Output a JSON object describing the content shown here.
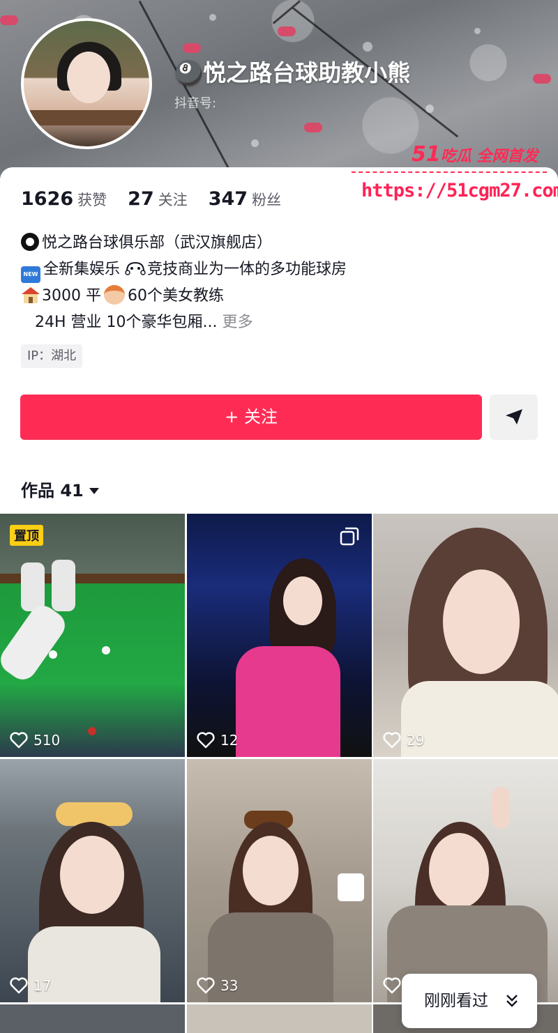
{
  "profile": {
    "name": "🎱悦之路台球助教小熊",
    "douyin_id_label": "抖音号:"
  },
  "stats": {
    "likes_value": "1626",
    "likes_label": "获赞",
    "following_value": "27",
    "following_label": "关注",
    "followers_value": "347",
    "followers_label": "粉丝"
  },
  "bio": {
    "line1": "悦之路台球俱乐部（武汉旗舰店）",
    "line2_a": "全新集娱乐",
    "line2_b": "竞技商业为一体的多功能球房",
    "line3_a": "3000 平",
    "line3_b": "60个美女教练",
    "line4": "24H 营业 10个豪华包厢...",
    "more": "更多",
    "new_badge": "NEW"
  },
  "ip_label": "IP：湖北",
  "watermark": {
    "brand_num": "51",
    "brand_text": "吃瓜 全网首发",
    "url": "https://51cgm27.com"
  },
  "actions": {
    "follow_label": "+ 关注",
    "share_icon": "send-icon"
  },
  "works_tab": {
    "label": "作品",
    "count": "41"
  },
  "videos": [
    {
      "likes": "510",
      "pinned": "置顶"
    },
    {
      "likes": "12"
    },
    {
      "likes": "29"
    },
    {
      "likes": "17"
    },
    {
      "likes": "33"
    },
    {
      "likes": ""
    }
  ],
  "recent_button": "刚刚看过",
  "colors": {
    "accent": "#fe2c55",
    "pin": "#fcce14"
  }
}
